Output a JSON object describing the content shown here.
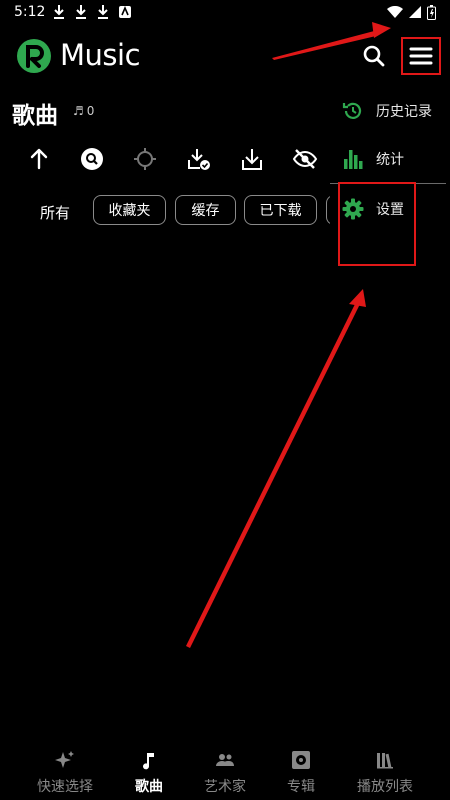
{
  "status_bar": {
    "time": "5:12"
  },
  "app_bar": {
    "title": "Music"
  },
  "header": {
    "title": "歌曲",
    "count": "0"
  },
  "filters": {
    "all": "所有",
    "chips": [
      "收藏夹",
      "缓存",
      "已下载"
    ]
  },
  "menu": {
    "items": [
      {
        "label": "历史记录",
        "icon": "history-icon"
      },
      {
        "label": "统计",
        "icon": "stats-icon"
      },
      {
        "label": "设置",
        "icon": "gear-icon"
      }
    ]
  },
  "bottom_nav": {
    "items": [
      {
        "label": "快速选择",
        "icon": "sparkle-icon",
        "active": false
      },
      {
        "label": "歌曲",
        "icon": "music-note-icon",
        "active": true
      },
      {
        "label": "艺术家",
        "icon": "people-icon",
        "active": false
      },
      {
        "label": "专辑",
        "icon": "album-icon",
        "active": false
      },
      {
        "label": "播放列表",
        "icon": "library-icon",
        "active": false
      }
    ]
  },
  "colors": {
    "accent": "#2fa84f",
    "annotation": "#e01818",
    "background": "#000000"
  }
}
